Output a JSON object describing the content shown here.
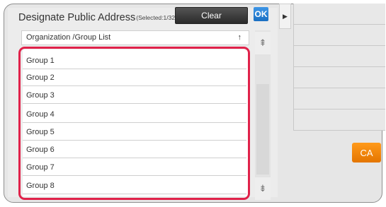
{
  "header": {
    "title": "Designate Public Address",
    "selected": "(Selected:1/32)",
    "clear_label": "Clear",
    "ok_label": "OK"
  },
  "list": {
    "header_label": "Organization /Group List",
    "sort_icon": "↑",
    "items": [
      "Group 1",
      "Group 2",
      "Group 3",
      "Group 4",
      "Group 5",
      "Group 6",
      "Group 7",
      "Group 8"
    ]
  },
  "scroll": {
    "up_icon": "⇞",
    "down_icon": "⇟"
  },
  "side": {
    "collapse_icon": "▶",
    "ca_label": "CA"
  },
  "colors": {
    "highlight": "#e0224a",
    "ok": "#1a6fc2",
    "ca": "#f08300"
  }
}
